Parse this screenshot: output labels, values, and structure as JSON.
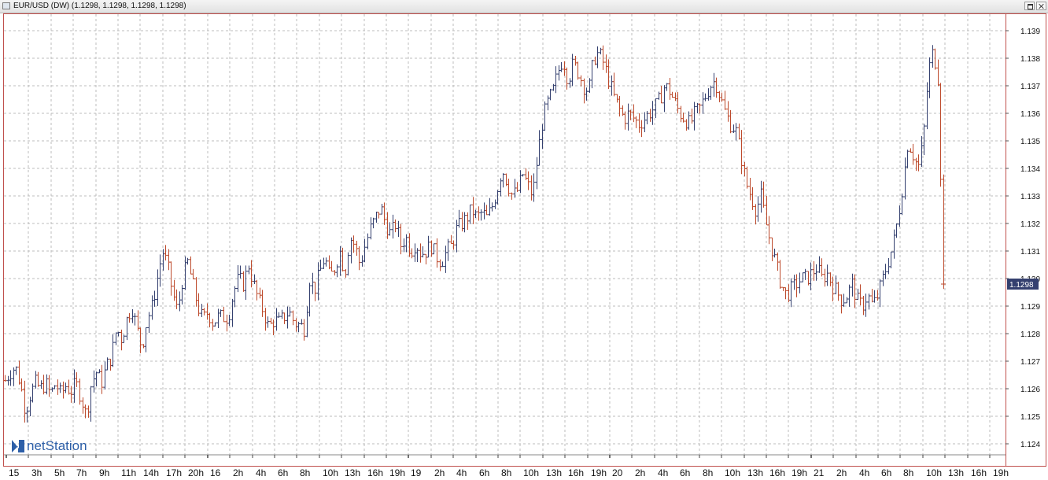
{
  "window": {
    "title": "EUR/USD (DW) (1.1298, 1.1298, 1.1298, 1.1298)",
    "icon": "chart-window-icon",
    "controls": [
      "restore-icon",
      "close-icon"
    ]
  },
  "brand": {
    "logo": "netStation",
    "icon": "netstation-n-icon"
  },
  "colors": {
    "up": "#34406f",
    "down": "#bd4a2c",
    "current_price_bg": "#34406f",
    "frame": "#c0504d",
    "grid": "#bdbdbd"
  },
  "chart_data": {
    "type": "ohlc",
    "title": "EUR/USD (DW)",
    "last_price_label": "1.1298",
    "last_price": 1.1298,
    "ylim": [
      1.1236,
      1.1395
    ],
    "y_ticks": [
      "1.124",
      "1.125",
      "1.126",
      "1.127",
      "1.128",
      "1.129",
      "1.130",
      "1.131",
      "1.132",
      "1.133",
      "1.134",
      "1.135",
      "1.136",
      "1.137",
      "1.138",
      "1.139"
    ],
    "x_ticks": [
      {
        "label": "15",
        "day": true
      },
      {
        "label": "3h"
      },
      {
        "label": "5h"
      },
      {
        "label": "7h"
      },
      {
        "label": "9h"
      },
      {
        "label": "11h"
      },
      {
        "label": "14h"
      },
      {
        "label": "17h"
      },
      {
        "label": "20h"
      },
      {
        "label": "16",
        "day": true
      },
      {
        "label": "2h"
      },
      {
        "label": "4h"
      },
      {
        "label": "6h"
      },
      {
        "label": "8h"
      },
      {
        "label": "10h"
      },
      {
        "label": "13h"
      },
      {
        "label": "16h"
      },
      {
        "label": "19h"
      },
      {
        "label": "19",
        "day": true
      },
      {
        "label": "2h"
      },
      {
        "label": "4h"
      },
      {
        "label": "6h"
      },
      {
        "label": "8h"
      },
      {
        "label": "10h"
      },
      {
        "label": "13h"
      },
      {
        "label": "16h"
      },
      {
        "label": "19h"
      },
      {
        "label": "20",
        "day": true
      },
      {
        "label": "2h"
      },
      {
        "label": "4h"
      },
      {
        "label": "6h"
      },
      {
        "label": "8h"
      },
      {
        "label": "10h"
      },
      {
        "label": "13h"
      },
      {
        "label": "16h"
      },
      {
        "label": "19h"
      },
      {
        "label": "21",
        "day": true
      },
      {
        "label": "2h"
      },
      {
        "label": "4h"
      },
      {
        "label": "6h"
      },
      {
        "label": "8h"
      },
      {
        "label": "10h"
      },
      {
        "label": "13h"
      },
      {
        "label": "16h"
      },
      {
        "label": "19h"
      }
    ],
    "close_path": [
      1.1263,
      1.1266,
      1.1268,
      1.1262,
      1.1252,
      1.1258,
      1.1262,
      1.126,
      1.1262,
      1.1258,
      1.1262,
      1.1258,
      1.1261,
      1.1259,
      1.1262,
      1.1257,
      1.125,
      1.1262,
      1.1266,
      1.1262,
      1.1268,
      1.1272,
      1.1282,
      1.1278,
      1.1285,
      1.129,
      1.1282,
      1.1275,
      1.1285,
      1.129,
      1.13,
      1.131,
      1.1305,
      1.1295,
      1.1288,
      1.13,
      1.1306,
      1.1298,
      1.129,
      1.1285,
      1.1288,
      1.1284,
      1.1286,
      1.1286,
      1.1286,
      1.1295,
      1.13,
      1.1298,
      1.1305,
      1.1298,
      1.1292,
      1.1288,
      1.1282,
      1.1285,
      1.1284,
      1.1286,
      1.1288,
      1.1284,
      1.1283,
      1.1282,
      1.13,
      1.1296,
      1.1302,
      1.1308,
      1.13,
      1.1304,
      1.131,
      1.1302,
      1.1315,
      1.1312,
      1.1305,
      1.1312,
      1.1318,
      1.1322,
      1.1326,
      1.132,
      1.1316,
      1.132,
      1.1312,
      1.1315,
      1.131,
      1.1313,
      1.1309,
      1.131,
      1.1312,
      1.1308,
      1.1306,
      1.131,
      1.1312,
      1.1318,
      1.132,
      1.1322,
      1.1325,
      1.1322,
      1.1324,
      1.1322,
      1.1326,
      1.1332,
      1.134,
      1.1335,
      1.133,
      1.1332,
      1.1338,
      1.1334,
      1.133,
      1.1345,
      1.1358,
      1.1364,
      1.1368,
      1.1375,
      1.138,
      1.1372,
      1.1378,
      1.1375,
      1.137,
      1.1368,
      1.138,
      1.1382,
      1.1378,
      1.1372,
      1.1366,
      1.1362,
      1.1358,
      1.136,
      1.1358,
      1.1356,
      1.1358,
      1.136,
      1.1362,
      1.1365,
      1.137,
      1.1368,
      1.1364,
      1.136,
      1.1358,
      1.1356,
      1.136,
      1.1362,
      1.1366,
      1.137,
      1.1372,
      1.1366,
      1.136,
      1.1356,
      1.1354,
      1.1345,
      1.1335,
      1.133,
      1.1325,
      1.133,
      1.132,
      1.1312,
      1.1305,
      1.1298,
      1.1294,
      1.1296,
      1.1298,
      1.13,
      1.13,
      1.1302,
      1.1304,
      1.13,
      1.1302,
      1.1298,
      1.1295,
      1.1292,
      1.1294,
      1.1298,
      1.1292,
      1.129,
      1.1294,
      1.129,
      1.1294,
      1.13,
      1.1306,
      1.1312,
      1.1322,
      1.1335,
      1.135,
      1.1345,
      1.134,
      1.135,
      1.1375,
      1.1383,
      1.1372,
      1.1298
    ]
  }
}
